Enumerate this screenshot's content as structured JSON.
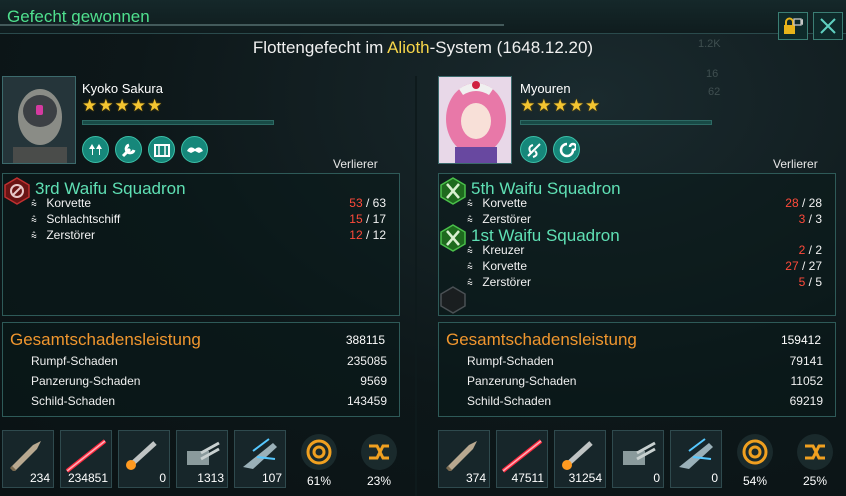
{
  "window": {
    "title": "Gefecht gewonnen",
    "subtitle_prefix": "Flottengefecht im ",
    "system_name": "Alioth",
    "subtitle_suffix": "-System (1648.12.20)"
  },
  "background_stats": {
    "a": "1.2K",
    "b": "16",
    "c": "62"
  },
  "left": {
    "leader_name": "Kyoko Sakura",
    "stars": "★★★★★",
    "result": "Verlierer",
    "traits": [
      "tree-icon",
      "wrench-icon",
      "crate-icon",
      "arms-icon"
    ],
    "fleets": [
      {
        "name": "3rd Waifu Squadron",
        "ships": [
          {
            "type": "Korvette",
            "lost": "53",
            "total": "63"
          },
          {
            "type": "Schlachtschiff",
            "lost": "15",
            "total": "17"
          },
          {
            "type": "Zerstörer",
            "lost": "12",
            "total": "12"
          }
        ]
      }
    ],
    "damage": {
      "title": "Gesamtschadensleistung",
      "total": "388115",
      "rows": [
        {
          "label": "Rumpf-Schaden",
          "value": "235085"
        },
        {
          "label": "Panzerung-Schaden",
          "value": "9569"
        },
        {
          "label": "Schild-Schaden",
          "value": "143459"
        }
      ]
    },
    "weapons": [
      {
        "icon": "kinetic-shell-icon",
        "value": "234"
      },
      {
        "icon": "laser-icon",
        "value": "234851"
      },
      {
        "icon": "missile-icon",
        "value": "0"
      },
      {
        "icon": "turret-icon",
        "value": "1313"
      },
      {
        "icon": "strike-craft-icon",
        "value": "107"
      }
    ],
    "stats": [
      {
        "icon": "target-icon",
        "value": "61%"
      },
      {
        "icon": "evasion-icon",
        "value": "23%"
      }
    ]
  },
  "right": {
    "leader_name": "Myouren",
    "stars": "★★★★★",
    "result": "Verlierer",
    "traits": [
      "leaf-icon",
      "swirl-icon"
    ],
    "fleets": [
      {
        "name": "5th Waifu Squadron",
        "ships": [
          {
            "type": "Korvette",
            "lost": "28",
            "total": "28"
          },
          {
            "type": "Zerstörer",
            "lost": "3",
            "total": "3"
          }
        ]
      },
      {
        "name": "1st Waifu Squadron",
        "ships": [
          {
            "type": "Kreuzer",
            "lost": "2",
            "total": "2"
          },
          {
            "type": "Korvette",
            "lost": "27",
            "total": "27"
          },
          {
            "type": "Zerstörer",
            "lost": "5",
            "total": "5"
          }
        ]
      }
    ],
    "damage": {
      "title": "Gesamtschadensleistung",
      "total": "159412",
      "rows": [
        {
          "label": "Rumpf-Schaden",
          "value": "79141"
        },
        {
          "label": "Panzerung-Schaden",
          "value": "11052"
        },
        {
          "label": "Schild-Schaden",
          "value": "69219"
        }
      ]
    },
    "weapons": [
      {
        "icon": "kinetic-shell-icon",
        "value": "374"
      },
      {
        "icon": "laser-icon",
        "value": "47511"
      },
      {
        "icon": "missile-icon",
        "value": "31254"
      },
      {
        "icon": "turret-icon",
        "value": "0"
      },
      {
        "icon": "strike-craft-icon",
        "value": "0"
      }
    ],
    "stats": [
      {
        "icon": "target-icon",
        "value": "54%"
      },
      {
        "icon": "evasion-icon",
        "value": "25%"
      }
    ]
  },
  "colors": {
    "title_green": "#4fe08e",
    "fleet_name": "#5fe0b4",
    "loss_red": "#ff4a3a",
    "damage_orange": "#f0962e",
    "star_gold": "#f4c531",
    "system_yellow": "#f7d64a"
  }
}
